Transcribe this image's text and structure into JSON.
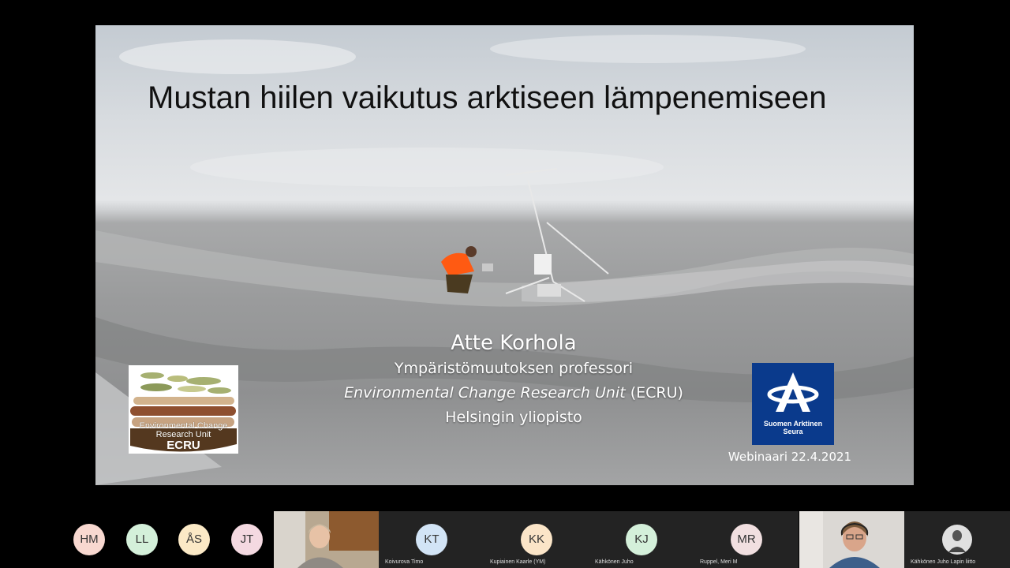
{
  "slide": {
    "title": "Mustan hiilen vaikutus arktiseen lämpenemiseen",
    "presenter_name": "Atte Korhola",
    "presenter_role": "Ympäristömuutoksen professori",
    "unit_name_italic": "Environmental Change Research Unit",
    "unit_abbrev": " (ECRU)",
    "university": "Helsingin yliopisto",
    "event_date": "Webinaari 22.4.2021",
    "logo_left": {
      "line1": "Environmental Change",
      "line2": "Research Unit",
      "line3": "ECRU"
    },
    "logo_right": {
      "line1": "Suomen Arktinen",
      "line2": "Seura"
    }
  },
  "participants": {
    "avatars": [
      {
        "initials": "HM",
        "color": "#f8d8d0"
      },
      {
        "initials": "LL",
        "color": "#d4f0da"
      },
      {
        "initials": "ÅS",
        "color": "#fbe9c6"
      },
      {
        "initials": "JT",
        "color": "#f4d9e1"
      }
    ],
    "tiles": [
      {
        "initials": "KT",
        "name": "Koivurova Timo",
        "color": "#d2e4f6"
      },
      {
        "initials": "KK",
        "name": "Kupiainen Kaarle (YM)",
        "color": "#fbe5c8"
      },
      {
        "initials": "KJ",
        "name": "Kähkönen Juho",
        "color": "#d4f0da"
      },
      {
        "initials": "MR",
        "name": "Ruppel, Meri M",
        "color": "#f1dfe0"
      }
    ],
    "last_tile_name": "Kähkönen Juho Lapin liitto"
  },
  "colors": {
    "slide_title": "#111111",
    "presenter_text": "#ffffff",
    "sas_blue": "#0a3a8c",
    "background": "#000000"
  }
}
